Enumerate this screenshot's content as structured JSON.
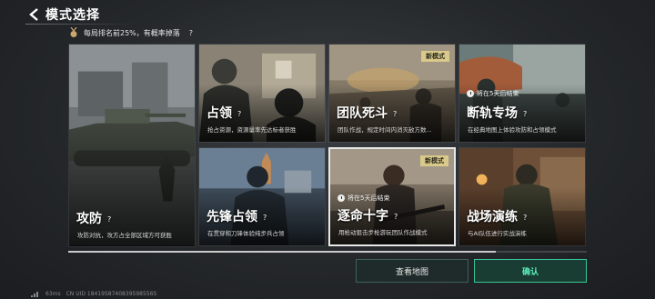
{
  "header": {
    "title": "模式选择"
  },
  "rank_tip": {
    "text": "每局排名前25%，有概率掉落",
    "help": "?"
  },
  "cards": [
    {
      "name": "攻防",
      "help": "?",
      "desc": "攻防对抗，攻方占全部区域方可获胜",
      "badge": "",
      "timer": ""
    },
    {
      "name": "占领",
      "help": "?",
      "desc": "抢占资源，资源量率先达标者获胜",
      "badge": "",
      "timer": ""
    },
    {
      "name": "团队死斗",
      "help": "?",
      "desc": "团队作战，规定时间内消灭敌方数...",
      "badge": "新模式",
      "timer": ""
    },
    {
      "name": "断轨专场",
      "help": "?",
      "desc": "在经典地图上体验攻防和占领模式",
      "badge": "",
      "timer": "将在5天后结束"
    },
    {
      "name": "先锋占领",
      "help": "?",
      "desc": "在贯穿和刀锋体验纯步兵占领",
      "badge": "",
      "timer": ""
    },
    {
      "name": "逐命十字",
      "help": "?",
      "desc": "用枪动狙击步枪游玩团队作战模式",
      "badge": "新模式",
      "timer": "将在5天后结束"
    },
    {
      "name": "战场演练",
      "help": "?",
      "desc": "与AI队伍进行实战演练",
      "badge": "",
      "timer": ""
    }
  ],
  "buttons": {
    "view_map": "查看地图",
    "confirm": "确认"
  },
  "footer": {
    "latency": "63ms",
    "uid": "CN UID 1841958740839598556S"
  },
  "colors": {
    "accent": "#37c796",
    "confirm_text": "#5cf0b9",
    "badge": "#d9c98a"
  }
}
